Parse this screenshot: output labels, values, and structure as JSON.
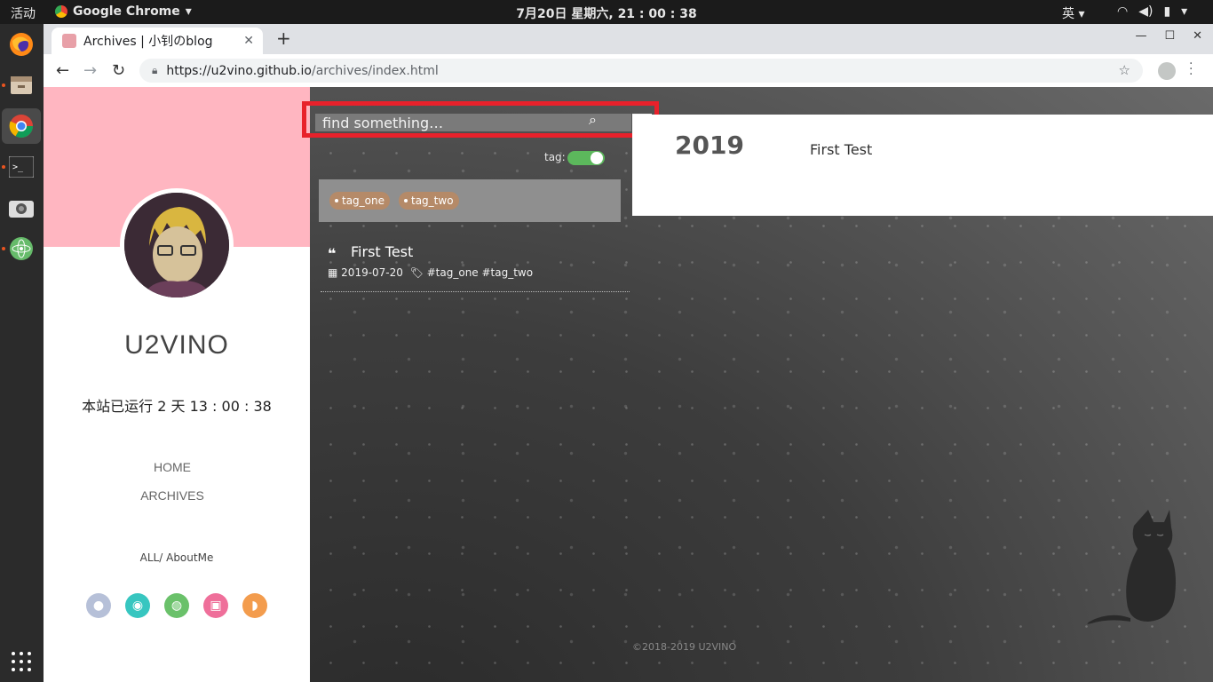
{
  "topbar": {
    "activities": "活动",
    "app_menu": "Google Chrome",
    "clock": "7月20日 星期六, 21 : 00 : 38",
    "input_method": "英"
  },
  "dock": {
    "apps": [
      "firefox-icon",
      "files-icon",
      "chrome-icon",
      "terminal-icon",
      "screenshot-icon",
      "atom-icon"
    ]
  },
  "browser": {
    "tab_title": "Archives | 小钊のblog",
    "url_host": "https://u2vino.github.io",
    "url_path": "/archives/index.html"
  },
  "sidebar": {
    "site_name": "U2VINO",
    "runtime": "本站已运行 2 天 13 : 00 : 38",
    "menu": [
      "HOME",
      "ARCHIVES"
    ],
    "filter_all": "ALL",
    "filter_about": "/ AboutMe",
    "social_colors": [
      "#b6c0d8",
      "#37c6c0",
      "#6ac16a",
      "#ef6f9a",
      "#f39c4d"
    ]
  },
  "search": {
    "placeholder": "find something…",
    "tag_label": "tag:",
    "tags": [
      "tag_one",
      "tag_two"
    ]
  },
  "posts": [
    {
      "title": "First Test",
      "date": "2019-07-20",
      "tags": "#tag_one  #tag_two"
    }
  ],
  "archive": {
    "year": "2019",
    "entry": "First Test"
  },
  "footer": "©2018-2019 U2VINO"
}
